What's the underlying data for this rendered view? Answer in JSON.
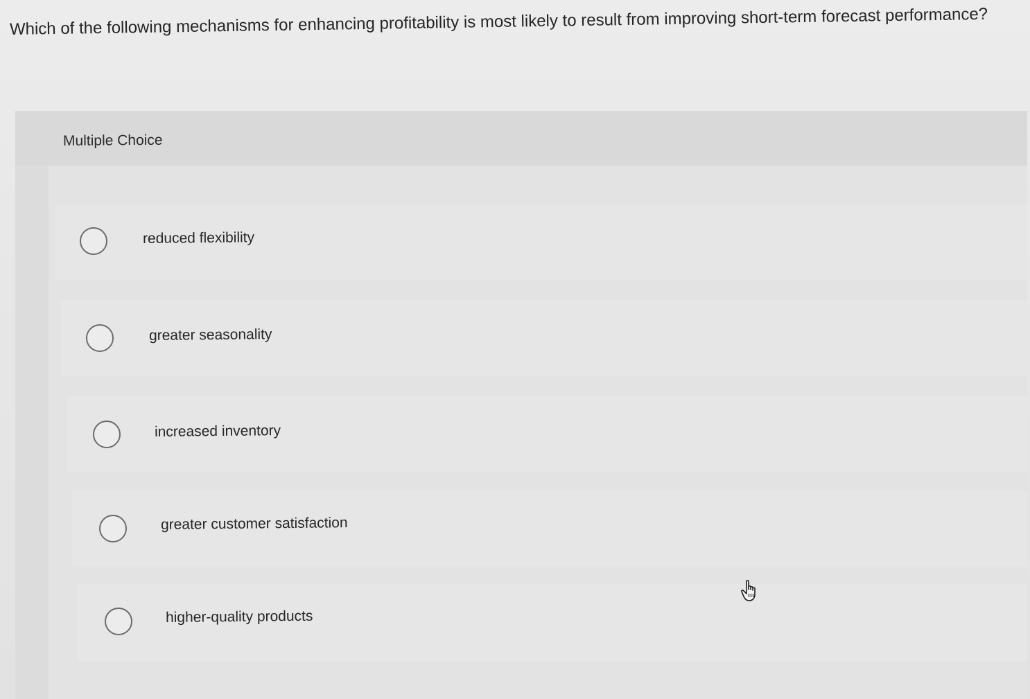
{
  "question": {
    "text": "Which of the following mechanisms for enhancing profitability is most likely to result from improving short-term forecast performance?"
  },
  "multiple_choice": {
    "label": "Multiple Choice",
    "options": [
      {
        "label": "reduced flexibility",
        "selected": false
      },
      {
        "label": "greater seasonality",
        "selected": false
      },
      {
        "label": "increased inventory",
        "selected": false
      },
      {
        "label": "greater customer satisfaction",
        "selected": false
      },
      {
        "label": "higher-quality products",
        "selected": false
      }
    ]
  },
  "cursor": {
    "icon": "hand-pointer-icon"
  }
}
